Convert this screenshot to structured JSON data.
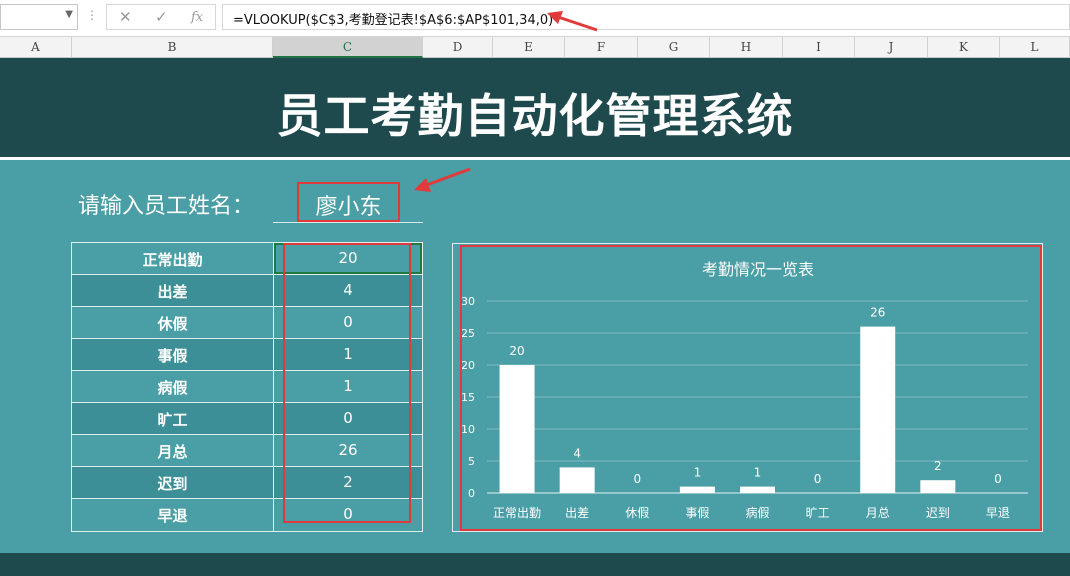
{
  "formula_bar": {
    "cancel_glyph": "✕",
    "enter_glyph": "✓",
    "fx_label": "fx",
    "formula": "=VLOOKUP($C$3,考勤登记表!$A$6:$AP$101,34,0)"
  },
  "columns": [
    "A",
    "B",
    "C",
    "D",
    "E",
    "F",
    "G",
    "H",
    "I",
    "J",
    "K",
    "L"
  ],
  "selected_column": "C",
  "title": "员工考勤自动化管理系统",
  "prompt_label": "请输入员工姓名：",
  "employee_name": "廖小东",
  "table": {
    "rows": [
      {
        "label": "正常出勤",
        "value": "20"
      },
      {
        "label": "出差",
        "value": "4"
      },
      {
        "label": "休假",
        "value": "0"
      },
      {
        "label": "事假",
        "value": "1"
      },
      {
        "label": "病假",
        "value": "1"
      },
      {
        "label": "旷工",
        "value": "0"
      },
      {
        "label": "月总",
        "value": "26"
      },
      {
        "label": "迟到",
        "value": "2"
      },
      {
        "label": "早退",
        "value": "0"
      }
    ]
  },
  "colors": {
    "banner": "#1e4a4d",
    "sheet": "#4a9ea6",
    "highlight": "#e23a3a",
    "bar": "#ffffff"
  },
  "chart_data": {
    "type": "bar",
    "title": "考勤情况一览表",
    "categories": [
      "正常出勤",
      "出差",
      "休假",
      "事假",
      "病假",
      "旷工",
      "月总",
      "迟到",
      "早退"
    ],
    "values": [
      20,
      4,
      0,
      1,
      1,
      0,
      26,
      2,
      0
    ],
    "ylim": [
      0,
      30
    ],
    "yticks": [
      0,
      5,
      10,
      15,
      20,
      25,
      30
    ],
    "grid": true,
    "data_labels": true
  }
}
